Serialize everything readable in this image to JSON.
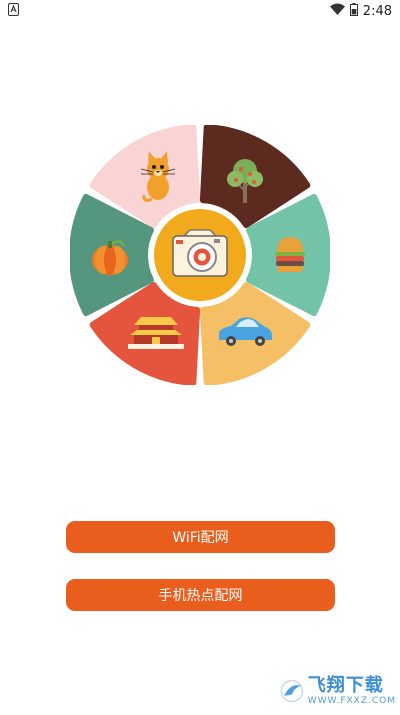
{
  "status_bar": {
    "time": "2:48",
    "icons": [
      "app-notification-icon",
      "wifi-icon",
      "battery-icon"
    ]
  },
  "wheel": {
    "segments": [
      {
        "name": "cat",
        "color": "#fad4d4"
      },
      {
        "name": "tree",
        "color": "#5c2a1e"
      },
      {
        "name": "burger",
        "color": "#73c3a9"
      },
      {
        "name": "car",
        "color": "#f5c065"
      },
      {
        "name": "palace",
        "color": "#e5553d"
      },
      {
        "name": "pumpkin",
        "color": "#55967f"
      }
    ],
    "center": {
      "icon": "camera-icon",
      "color": "#f2aa1d"
    }
  },
  "buttons": {
    "wifi_label": "WiFi配网",
    "hotspot_label": "手机热点配网",
    "color": "#e95d1d"
  },
  "watermark": {
    "main": "飞翔下载",
    "sub": "WWW.FXXZ.COM"
  }
}
